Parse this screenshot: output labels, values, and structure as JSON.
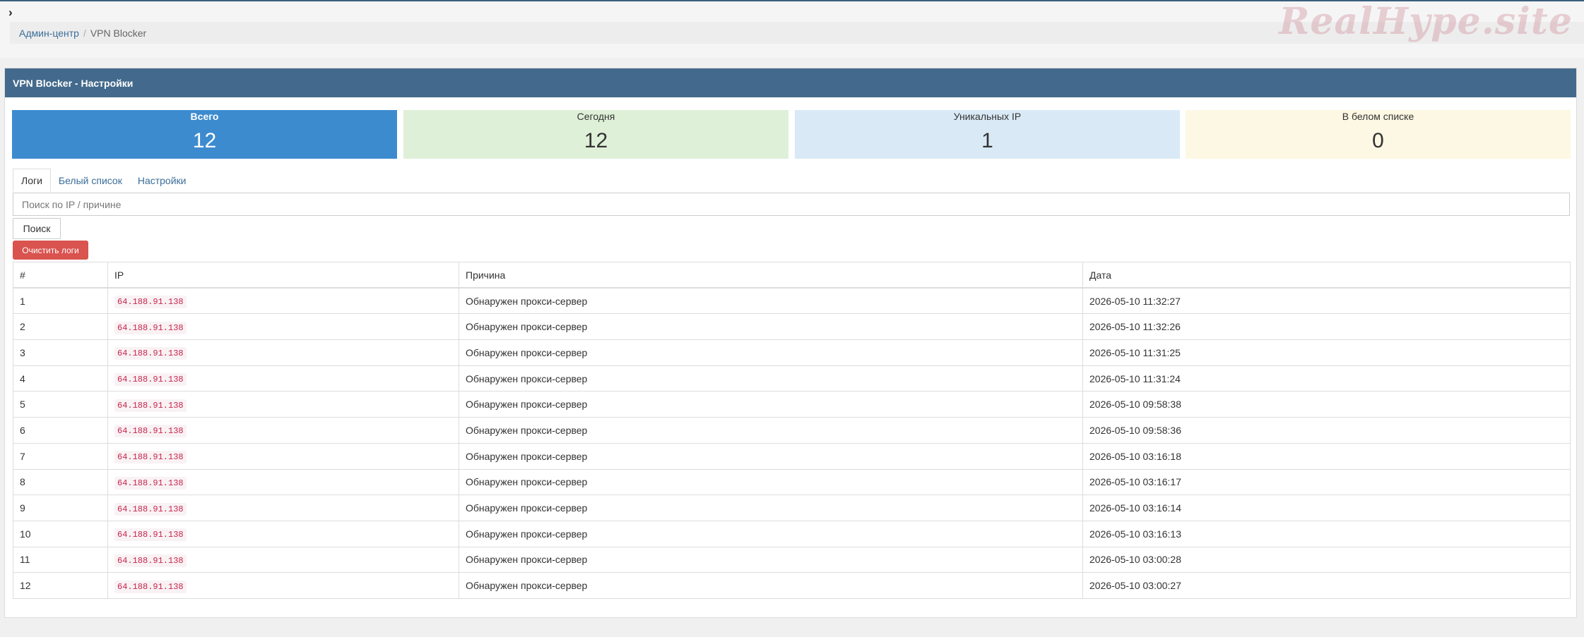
{
  "watermark": "RealHype.site",
  "breadcrumb": {
    "home": "Админ-центр",
    "separator": "/",
    "current": "VPN Blocker"
  },
  "panel": {
    "title": "VPN Blocker - Настройки"
  },
  "stats": {
    "total": {
      "label": "Всего",
      "value": "12",
      "color": "#3d8bcf"
    },
    "today": {
      "label": "Сегодня",
      "value": "12",
      "color": "#dff0d8"
    },
    "unique": {
      "label": "Уникальных IP",
      "value": "1",
      "color": "#d9eaf6"
    },
    "whitelist": {
      "label": "В белом списке",
      "value": "0",
      "color": "#fcf8e3"
    }
  },
  "tabs": [
    {
      "label": "Логи",
      "active": true
    },
    {
      "label": "Белый список",
      "active": false
    },
    {
      "label": "Настройки",
      "active": false
    }
  ],
  "search": {
    "placeholder": "Поиск по IP / причине",
    "value": "",
    "button_label": "Поиск"
  },
  "clear_button_label": "Очистить логи",
  "table": {
    "columns": [
      "#",
      "IP",
      "Причина",
      "Дата"
    ],
    "rows": [
      {
        "id": "1",
        "ip": "64.188.91.138",
        "reason": "Обнаружен прокси-сервер",
        "date": "2026-05-10 11:32:27"
      },
      {
        "id": "2",
        "ip": "64.188.91.138",
        "reason": "Обнаружен прокси-сервер",
        "date": "2026-05-10 11:32:26"
      },
      {
        "id": "3",
        "ip": "64.188.91.138",
        "reason": "Обнаружен прокси-сервер",
        "date": "2026-05-10 11:31:25"
      },
      {
        "id": "4",
        "ip": "64.188.91.138",
        "reason": "Обнаружен прокси-сервер",
        "date": "2026-05-10 11:31:24"
      },
      {
        "id": "5",
        "ip": "64.188.91.138",
        "reason": "Обнаружен прокси-сервер",
        "date": "2026-05-10 09:58:38"
      },
      {
        "id": "6",
        "ip": "64.188.91.138",
        "reason": "Обнаружен прокси-сервер",
        "date": "2026-05-10 09:58:36"
      },
      {
        "id": "7",
        "ip": "64.188.91.138",
        "reason": "Обнаружен прокси-сервер",
        "date": "2026-05-10 03:16:18"
      },
      {
        "id": "8",
        "ip": "64.188.91.138",
        "reason": "Обнаружен прокси-сервер",
        "date": "2026-05-10 03:16:17"
      },
      {
        "id": "9",
        "ip": "64.188.91.138",
        "reason": "Обнаружен прокси-сервер",
        "date": "2026-05-10 03:16:14"
      },
      {
        "id": "10",
        "ip": "64.188.91.138",
        "reason": "Обнаружен прокси-сервер",
        "date": "2026-05-10 03:16:13"
      },
      {
        "id": "11",
        "ip": "64.188.91.138",
        "reason": "Обнаружен прокси-сервер",
        "date": "2026-05-10 03:00:28"
      },
      {
        "id": "12",
        "ip": "64.188.91.138",
        "reason": "Обнаружен прокси-сервер",
        "date": "2026-05-10 03:00:27"
      }
    ]
  }
}
